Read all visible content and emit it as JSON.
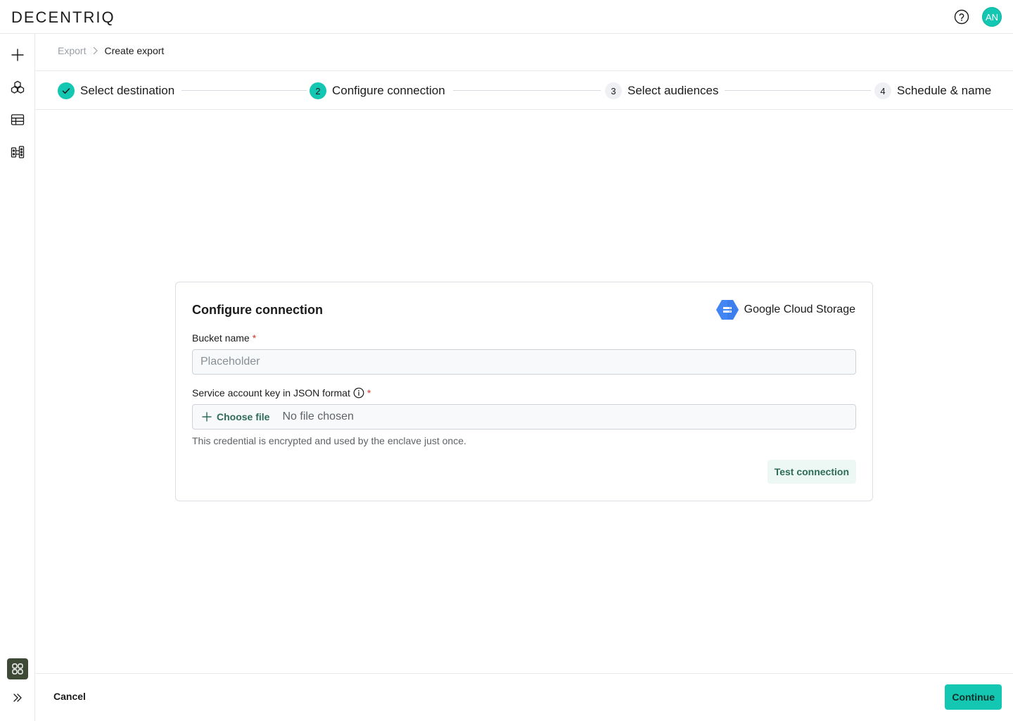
{
  "app": {
    "logo": "DECENTRIQ",
    "avatar_initials": "AN"
  },
  "icons": {
    "help": "help-circle-icon",
    "sidebar": [
      "plus-icon",
      "cube-icon",
      "table-icon",
      "panels-icon"
    ],
    "sidebar_active": "grid-icon",
    "expand": "double-chevron-right-icon"
  },
  "breadcrumb": {
    "parent": "Export",
    "current": "Create export"
  },
  "steps": [
    {
      "number": "1",
      "label": "Select destination",
      "state": "done"
    },
    {
      "number": "2",
      "label": "Configure connection",
      "state": "active"
    },
    {
      "number": "3",
      "label": "Select audiences",
      "state": "pending"
    },
    {
      "number": "4",
      "label": "Schedule & name",
      "state": "pending"
    }
  ],
  "card": {
    "title": "Configure connection",
    "provider": "Google Cloud Storage",
    "bucket": {
      "label": "Bucket name",
      "required_mark": "*",
      "placeholder": "Placeholder",
      "value": ""
    },
    "key": {
      "label": "Service account key in JSON format",
      "required_mark": "*",
      "choose_label": "Choose file",
      "file_status": "No file chosen",
      "helper": "This credential is encrypted and used by the enclave just once."
    },
    "test_label": "Test connection"
  },
  "footer": {
    "cancel_label": "Cancel",
    "continue_label": "Continue"
  },
  "colors": {
    "accent": "#14c7b2",
    "accent_text": "#2e6b58",
    "required": "#d9342b",
    "gcs_blue": "#4285f4"
  }
}
